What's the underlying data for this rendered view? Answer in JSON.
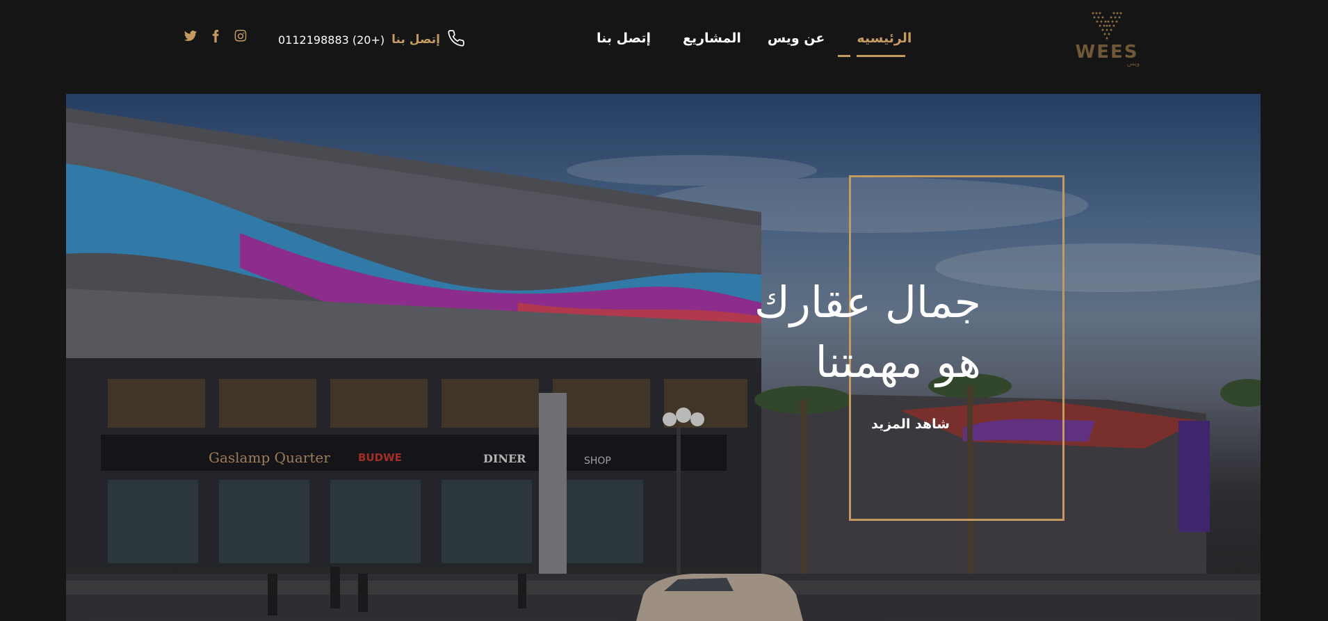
{
  "header": {
    "social": [
      {
        "name": "twitter-icon"
      },
      {
        "name": "facebook-icon"
      },
      {
        "name": "instagram-icon"
      }
    ],
    "contact": {
      "label": "إتصل بنا",
      "number": "0112198883 (20+)"
    },
    "nav": [
      {
        "label": "الرئيسيه",
        "active": true
      },
      {
        "label": "عن ويس",
        "active": false
      },
      {
        "label": "المشاريع",
        "active": false
      },
      {
        "label": "إتصل بنا",
        "active": false
      }
    ],
    "logo": {
      "text": "WEES",
      "subtext": "ويس"
    }
  },
  "hero": {
    "headline_line1": "جمال عقارك",
    "headline_line2": "هو مهمتنا",
    "cta": "شاهد المزيد",
    "signs": [
      "Gaslamp Quarter",
      "BUDWE",
      "DINER",
      "SHOP"
    ]
  },
  "colors": {
    "accent": "#c49a63",
    "background": "#151515",
    "text": "#ffffff"
  }
}
